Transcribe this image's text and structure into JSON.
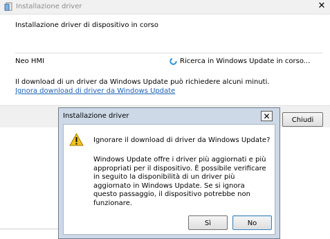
{
  "window": {
    "title": "Installazione driver",
    "close_glyph": "✕"
  },
  "main": {
    "status_line": "Installazione driver di dispositivo in corso",
    "device_name": "Neo HMI",
    "search_status": "Ricerca in Windows Update in corso...",
    "info_line": "Il download di un driver da Windows Update può richiedere alcuni minuti.",
    "ignore_link": "Ignora download di driver da Windows Update",
    "close_button": "Chiudi"
  },
  "dialog": {
    "title": "Installazione driver",
    "close_glyph": "✕",
    "question": "Ignorare il download di driver da Windows Update?",
    "message": "Windows Update offre i driver più aggiornati e più appropriati per il dispositivo. È possibile verificare in seguito la disponibilità di un driver più aggiornato in Windows Update. Se si ignora questo passaggio, il dispositivo potrebbe non funzionare.",
    "yes_button": "Sì",
    "no_button": "No"
  },
  "icons": {
    "app": "driver-install-icon",
    "spinner": "busy-spinner-icon",
    "warning": "warning-icon"
  },
  "colors": {
    "link": "#1a5fb4",
    "dialog_frame": "#cdd9e7",
    "spinner": "#2c8fd6",
    "warning": "#f2c21b"
  }
}
